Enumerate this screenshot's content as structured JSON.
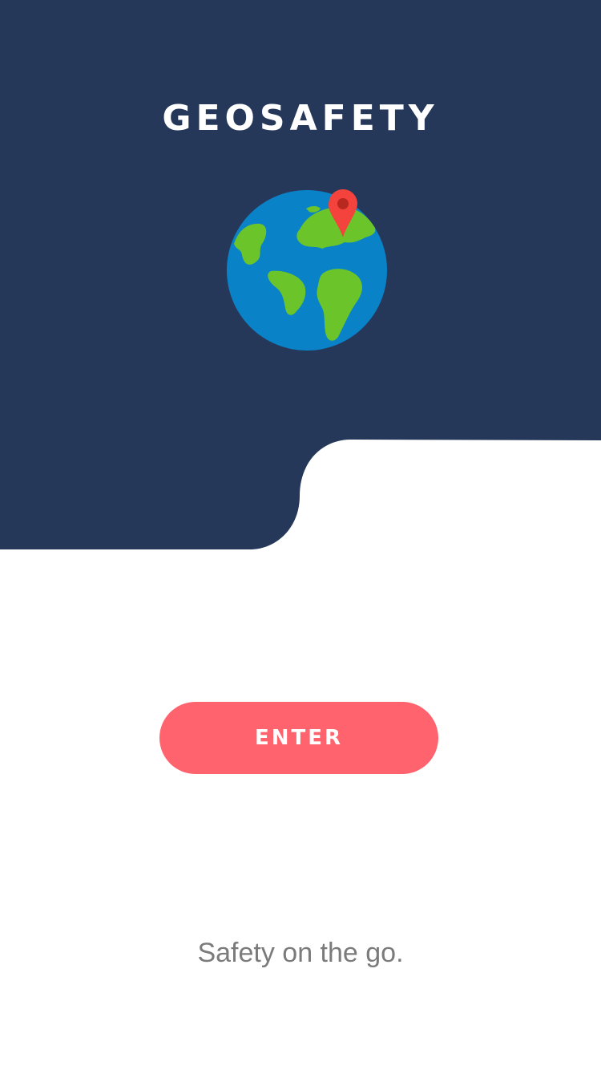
{
  "app": {
    "title": "GEOSAFETY",
    "tagline": "Safety on the go."
  },
  "actions": {
    "enter_label": "ENTER"
  },
  "illustration": {
    "icon": "globe-with-location-pin-icon"
  },
  "colors": {
    "hero_background": "#26385a",
    "button_background": "#ff646e",
    "ocean": "#0a82c8",
    "land": "#6bc42a",
    "pin": "#f4433c",
    "tagline_text": "#7b7b7b"
  }
}
